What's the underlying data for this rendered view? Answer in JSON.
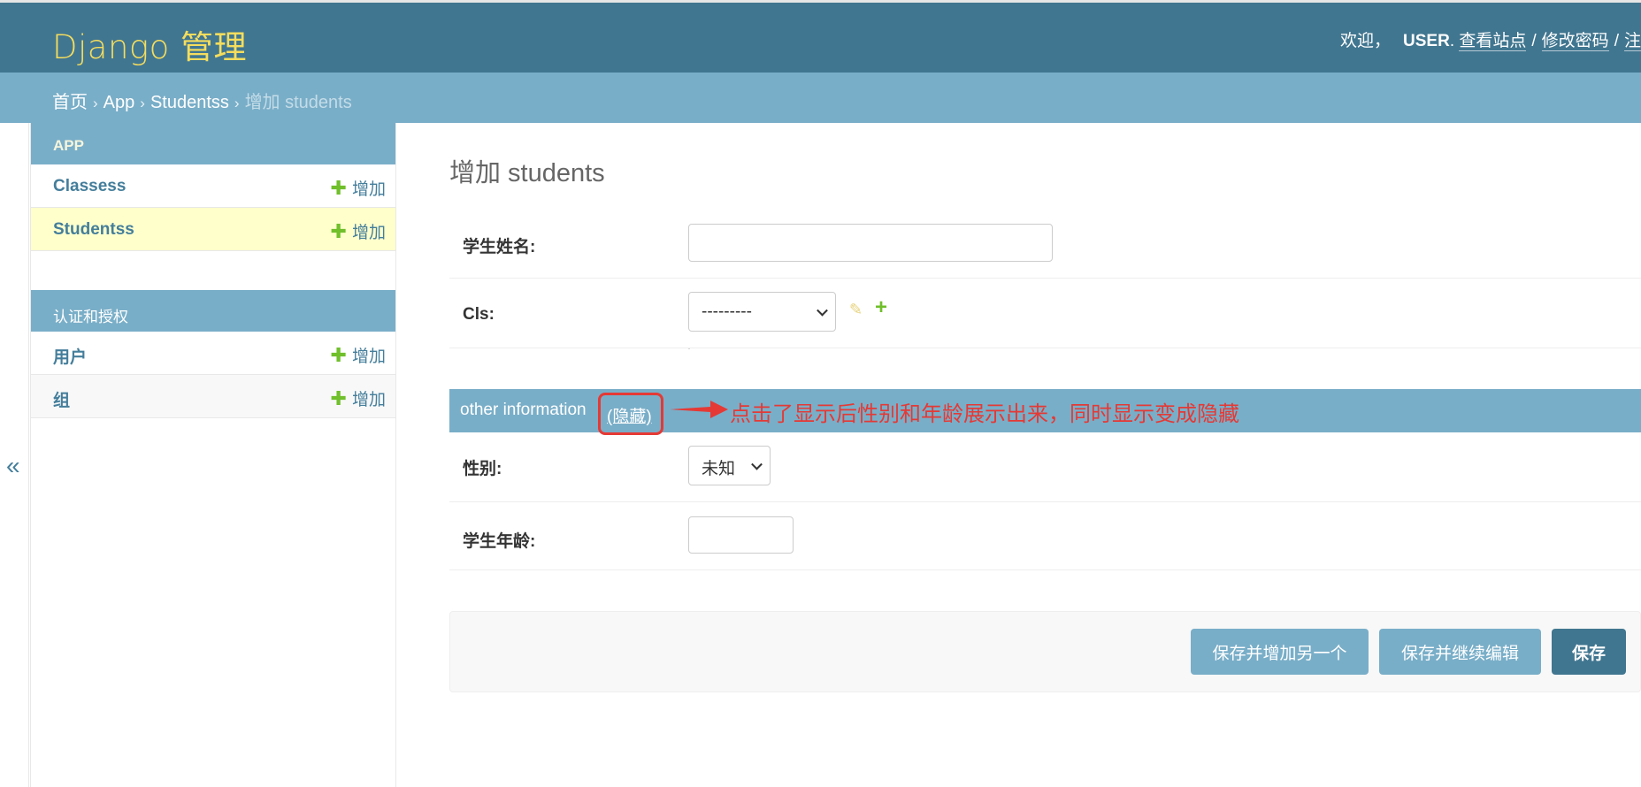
{
  "header": {
    "brand": "Django 管理",
    "welcome": "欢迎，",
    "username": "USER",
    "view_site": "查看站点",
    "change_password": "修改密码",
    "logout": "注销",
    "separator": "/"
  },
  "breadcrumbs": {
    "home": "首页",
    "app": "App",
    "model": "Studentss",
    "current": "增加 students",
    "chevron": "›"
  },
  "sidebar": {
    "toggle": "«",
    "modules": [
      {
        "caption": "APP",
        "models": [
          {
            "name": "Classess",
            "add": "增加"
          },
          {
            "name": "Studentss",
            "add": "增加"
          }
        ]
      },
      {
        "caption": "认证和授权",
        "models": [
          {
            "name": "用户",
            "add": "增加"
          },
          {
            "name": "组",
            "add": "增加"
          }
        ]
      }
    ]
  },
  "form": {
    "title": "增加 students",
    "fields": {
      "name_label": "学生姓名:",
      "name_value": "",
      "cls_label": "Cls:",
      "cls_value": "---------",
      "gender_label": "性别:",
      "gender_value": "未知",
      "age_label": "学生年龄:",
      "age_value": ""
    },
    "fieldset": {
      "title": "other information",
      "toggle": "(隐藏)"
    },
    "annotation": "点击了显示后性别和年龄展示出来，同时显示变成隐藏",
    "buttons": {
      "save_add_another": "保存并增加另一个",
      "save_continue": "保存并继续编辑",
      "save": "保存"
    }
  },
  "colors": {
    "header_bg": "#417690",
    "breadcrumb_bg": "#79aec8",
    "brand": "#f5dd5d",
    "link": "#447e9b",
    "add_plus": "#70bf2b",
    "current_row": "#ffffcc",
    "annotation": "#e53935"
  }
}
